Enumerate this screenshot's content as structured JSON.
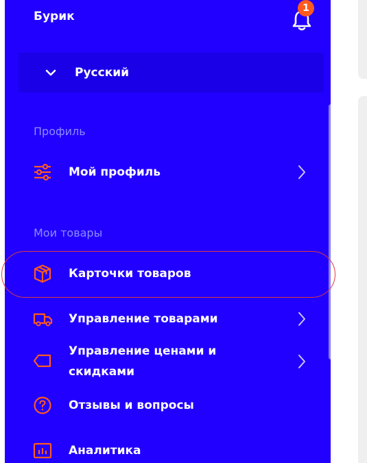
{
  "header": {
    "user_name": "Бурик",
    "notification_count": "1"
  },
  "language": {
    "current": "Русский"
  },
  "sections": {
    "profile_title": "Профиль",
    "products_title": "Мои товары"
  },
  "menu": {
    "my_profile": "Мой профиль",
    "product_cards": "Карточки товаров",
    "product_management": "Управление товарами",
    "price_management_line1": "Управление ценами и",
    "price_management_line2": "скидками",
    "reviews": "Отзывы и вопросы",
    "analytics": "Аналитика"
  },
  "colors": {
    "sidebar_bg": "#2200ff",
    "accent": "#ff5a1f",
    "section_title": "#8c8cff",
    "highlight": "#e03a3a"
  },
  "icons": {
    "bell": "bell-icon",
    "chevron_down": "chevron-down-icon",
    "sliders": "sliders-icon",
    "box": "box-icon",
    "truck": "truck-icon",
    "tag": "tag-icon",
    "question": "question-circle-icon",
    "chart": "bar-chart-icon",
    "arrow_right": "chevron-right-icon"
  }
}
